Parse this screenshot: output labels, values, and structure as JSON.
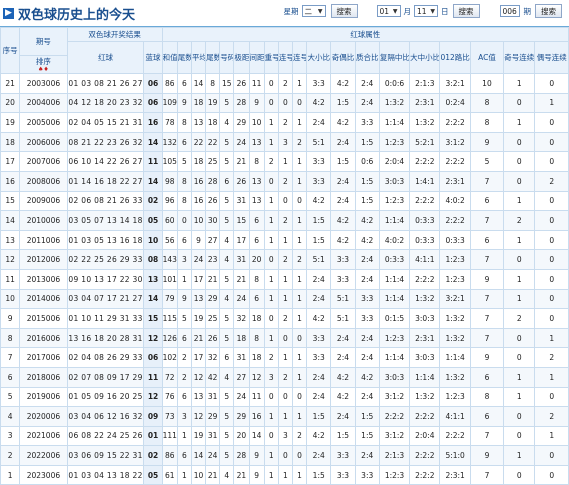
{
  "page": {
    "title": "双色球历史上的今天",
    "title_icon": "play-arrow-icon"
  },
  "controls": {
    "week_label": "星期",
    "week_value": "二",
    "search1": "搜索",
    "month_value": "01",
    "month_label": "月",
    "day_value": "11",
    "day_label": "日",
    "search2": "搜索",
    "issue_value": "006",
    "issue_label": "期",
    "search3": "搜索"
  },
  "headers": {
    "seq": "序号",
    "issue": "期号",
    "issue_sub": "排序",
    "result_group": "双色球开奖结果",
    "red": "红球",
    "blue": "蓝球",
    "attr_group": "红球属性",
    "sum": "和值",
    "tail_count": "尾数",
    "avg": "平均值",
    "tail_sum": "尾数和值",
    "span": "号码组",
    "max_gap": "极距",
    "max_gap2": "间距",
    "repeat": "重号个数",
    "consec": "连号个数",
    "consec2": "连号组数",
    "bigsmall": "大小比",
    "oddeven": "奇偶比",
    "prime": "质合比",
    "gap": "复隔中比",
    "daxiao": "大中小比",
    "012": "012路比",
    "ac": "AC值",
    "odd_consec": "奇号连续",
    "even_consec": "偶号连续"
  },
  "colors": {
    "accent": "#1a4f8f",
    "red_ball": "#d42a1f",
    "blue_ball": "#1c5bb0",
    "header_bg": "#e9f2fb"
  },
  "rows": [
    [
      "21",
      "2003006",
      "01 03 08 21 26 27",
      "06",
      "86",
      "6",
      "14",
      "8",
      "15",
      "26",
      "11",
      "0",
      "2",
      "1",
      "3:3",
      "4:2",
      "2:4",
      "0:0:6",
      "2:1:3",
      "3:2:1",
      "10",
      "1",
      "0"
    ],
    [
      "20",
      "2004006",
      "04 12 18 20 23 32",
      "06",
      "109",
      "9",
      "18",
      "19",
      "5",
      "28",
      "9",
      "0",
      "0",
      "0",
      "4:2",
      "1:5",
      "2:4",
      "1:3:2",
      "2:3:1",
      "0:2:4",
      "8",
      "0",
      "1"
    ],
    [
      "19",
      "2005006",
      "02 04 05 15 21 31",
      "16",
      "78",
      "8",
      "13",
      "18",
      "4",
      "29",
      "10",
      "1",
      "2",
      "1",
      "2:4",
      "4:2",
      "3:3",
      "1:1:4",
      "1:3:2",
      "2:2:2",
      "8",
      "1",
      "0"
    ],
    [
      "18",
      "2006006",
      "08 21 22 23 26 32",
      "14",
      "132",
      "6",
      "22",
      "22",
      "5",
      "24",
      "13",
      "1",
      "3",
      "2",
      "5:1",
      "2:4",
      "1:5",
      "1:2:3",
      "5:2:1",
      "3:1:2",
      "9",
      "0",
      "0"
    ],
    [
      "17",
      "2007006",
      "06 10 14 22 26 27",
      "11",
      "105",
      "5",
      "18",
      "25",
      "5",
      "21",
      "8",
      "2",
      "1",
      "1",
      "3:3",
      "1:5",
      "0:6",
      "2:0:4",
      "2:2:2",
      "2:2:2",
      "5",
      "0",
      "0"
    ],
    [
      "16",
      "2008006",
      "01 14 16 18 22 27",
      "14",
      "98",
      "8",
      "16",
      "28",
      "6",
      "26",
      "13",
      "0",
      "2",
      "1",
      "3:3",
      "2:4",
      "1:5",
      "3:0:3",
      "1:4:1",
      "2:3:1",
      "7",
      "0",
      "2"
    ],
    [
      "15",
      "2009006",
      "02 06 08 21 26 33",
      "02",
      "96",
      "8",
      "16",
      "26",
      "5",
      "31",
      "13",
      "1",
      "0",
      "0",
      "4:2",
      "2:4",
      "1:5",
      "1:2:3",
      "2:2:2",
      "4:0:2",
      "6",
      "1",
      "0"
    ],
    [
      "14",
      "2010006",
      "03 05 07 13 14 18",
      "05",
      "60",
      "0",
      "10",
      "30",
      "5",
      "15",
      "6",
      "1",
      "2",
      "1",
      "1:5",
      "4:2",
      "4:2",
      "1:1:4",
      "0:3:3",
      "2:2:2",
      "7",
      "2",
      "0"
    ],
    [
      "13",
      "2011006",
      "01 03 05 13 16 18",
      "10",
      "56",
      "6",
      "9",
      "27",
      "4",
      "17",
      "6",
      "1",
      "1",
      "1",
      "1:5",
      "4:2",
      "4:2",
      "4:0:2",
      "0:3:3",
      "0:3:3",
      "6",
      "1",
      "0"
    ],
    [
      "12",
      "2012006",
      "02 22 25 26 29 33",
      "08",
      "143",
      "3",
      "24",
      "23",
      "4",
      "31",
      "20",
      "0",
      "2",
      "2",
      "5:1",
      "3:3",
      "2:4",
      "0:3:3",
      "4:1:1",
      "1:2:3",
      "7",
      "0",
      "0"
    ],
    [
      "11",
      "2013006",
      "09 10 13 17 22 30",
      "13",
      "101",
      "1",
      "17",
      "21",
      "5",
      "21",
      "8",
      "1",
      "1",
      "1",
      "2:4",
      "3:3",
      "2:4",
      "1:1:4",
      "2:2:2",
      "1:2:3",
      "9",
      "1",
      "0"
    ],
    [
      "10",
      "2014006",
      "03 04 07 17 21 27",
      "14",
      "79",
      "9",
      "13",
      "29",
      "4",
      "24",
      "6",
      "1",
      "1",
      "1",
      "2:4",
      "5:1",
      "3:3",
      "1:1:4",
      "1:3:2",
      "3:2:1",
      "7",
      "1",
      "0"
    ],
    [
      "9",
      "2015006",
      "01 10 11 29 31 33",
      "15",
      "115",
      "5",
      "19",
      "25",
      "5",
      "32",
      "18",
      "0",
      "2",
      "1",
      "4:2",
      "5:1",
      "3:3",
      "0:1:5",
      "3:0:3",
      "1:3:2",
      "7",
      "2",
      "0"
    ],
    [
      "8",
      "2016006",
      "13 16 18 20 28 31",
      "12",
      "126",
      "6",
      "21",
      "26",
      "5",
      "18",
      "8",
      "1",
      "0",
      "0",
      "3:3",
      "2:4",
      "2:4",
      "1:2:3",
      "2:3:1",
      "1:3:2",
      "7",
      "0",
      "1"
    ],
    [
      "7",
      "2017006",
      "02 04 08 26 29 33",
      "06",
      "102",
      "2",
      "17",
      "32",
      "6",
      "31",
      "18",
      "2",
      "1",
      "1",
      "3:3",
      "2:4",
      "2:4",
      "1:1:4",
      "3:0:3",
      "1:1:4",
      "9",
      "0",
      "2"
    ],
    [
      "6",
      "2018006",
      "02 07 08 09 17 29",
      "11",
      "72",
      "2",
      "12",
      "42",
      "4",
      "27",
      "12",
      "3",
      "2",
      "1",
      "2:4",
      "4:2",
      "4:2",
      "3:0:3",
      "1:1:4",
      "1:3:2",
      "6",
      "1",
      "1"
    ],
    [
      "5",
      "2019006",
      "01 05 09 16 20 25",
      "12",
      "76",
      "6",
      "13",
      "31",
      "5",
      "24",
      "11",
      "0",
      "0",
      "0",
      "2:4",
      "4:2",
      "2:4",
      "3:1:2",
      "1:3:2",
      "1:2:3",
      "8",
      "1",
      "0"
    ],
    [
      "4",
      "2020006",
      "03 04 06 12 16 32",
      "09",
      "73",
      "3",
      "12",
      "29",
      "5",
      "29",
      "16",
      "1",
      "1",
      "1",
      "1:5",
      "2:4",
      "1:5",
      "2:2:2",
      "2:2:2",
      "4:1:1",
      "6",
      "0",
      "2"
    ],
    [
      "3",
      "2021006",
      "06 08 22 24 25 26",
      "01",
      "111",
      "1",
      "19",
      "31",
      "5",
      "20",
      "14",
      "0",
      "3",
      "2",
      "4:2",
      "1:5",
      "1:5",
      "3:1:2",
      "2:0:4",
      "2:2:2",
      "7",
      "0",
      "1"
    ],
    [
      "2",
      "2022006",
      "03 06 09 15 22 31",
      "02",
      "86",
      "6",
      "14",
      "24",
      "5",
      "28",
      "9",
      "1",
      "0",
      "0",
      "2:4",
      "3:3",
      "2:4",
      "2:1:3",
      "2:2:2",
      "5:1:0",
      "9",
      "1",
      "0"
    ],
    [
      "1",
      "2023006",
      "01 03 04 13 18 22",
      "05",
      "61",
      "1",
      "10",
      "21",
      "4",
      "21",
      "9",
      "1",
      "1",
      "1",
      "1:5",
      "3:3",
      "3:3",
      "1:2:3",
      "2:2:2",
      "2:3:1",
      "7",
      "0",
      "0"
    ]
  ]
}
